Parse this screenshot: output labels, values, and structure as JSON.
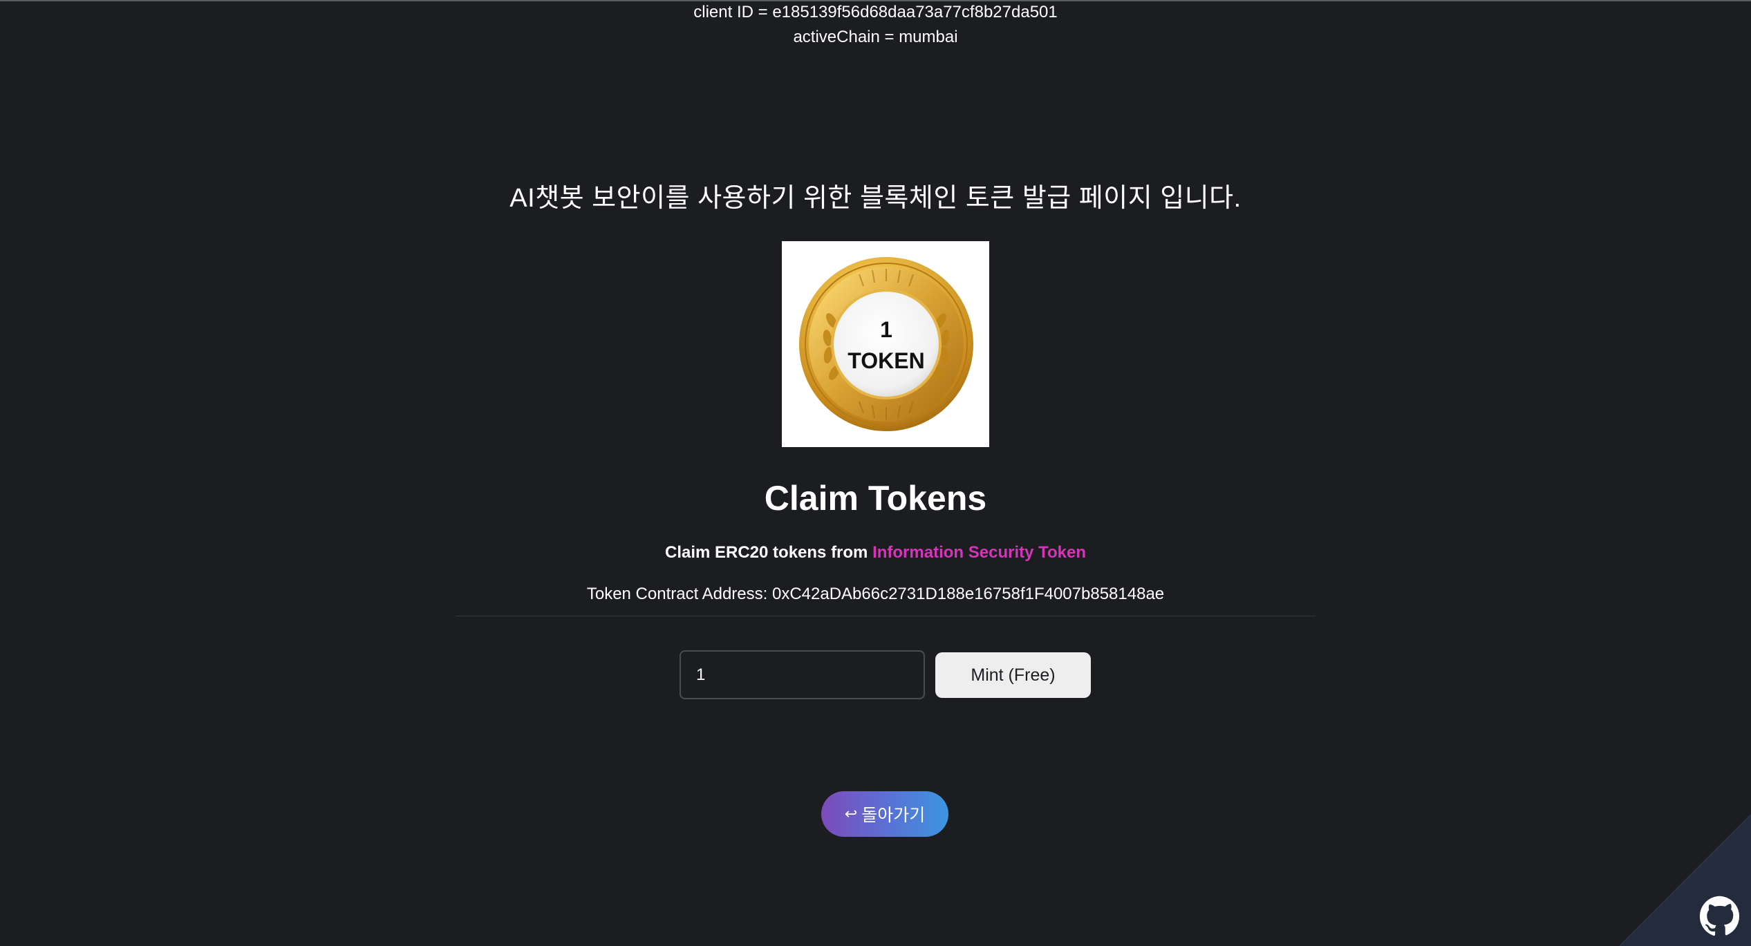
{
  "header": {
    "client_id_text": "client ID = e185139f56d68daa73a77cf8b27da501",
    "active_chain_text": "activeChain = mumbai"
  },
  "main": {
    "korean_heading": "AI챗봇 보안이를 사용하기 위한 블록체인 토큰 발급 페이지 입니다.",
    "coin_image": {
      "number": "1",
      "label": "TOKEN"
    },
    "claim_title": "Claim Tokens",
    "claim_prefix": "Claim ERC20 tokens from ",
    "token_name": "Information Security Token",
    "contract_text": "Token Contract Address: 0xC42aDAb66c2731D188e16758f1F4007b858148ae",
    "mint_form": {
      "quantity_value": "1",
      "mint_label": "Mint (Free)"
    },
    "back_button": {
      "arrow": "↩",
      "label": "돌아가기"
    }
  },
  "corner": {
    "icon": "github-icon"
  },
  "colors": {
    "background": "#1c1d21",
    "link_accent": "#d535b9",
    "button_light": "#eeeeee",
    "gradient_start": "#7d4ab9",
    "gradient_end": "#3c95e0",
    "coin_gold": "#d4a437"
  }
}
